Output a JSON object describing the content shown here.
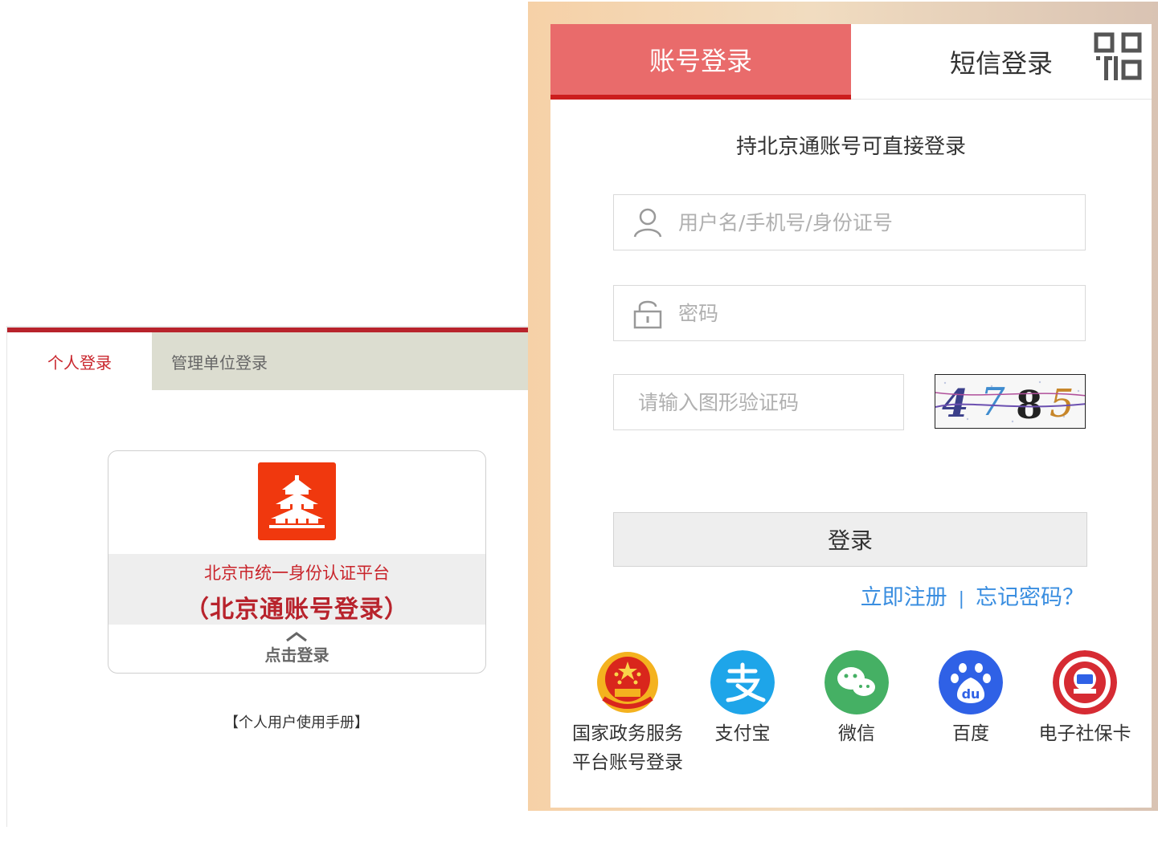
{
  "left": {
    "tabs": {
      "personal": "个人登录",
      "org": "管理单位登录"
    },
    "card": {
      "line1": "北京市统一身份认证平台",
      "line2": "（北京通账号登录）",
      "click": "点击登录"
    },
    "manual": "【个人用户使用手册】"
  },
  "right": {
    "tabs": {
      "account": "账号登录",
      "sms": "短信登录"
    },
    "subtitle": "持北京通账号可直接登录",
    "username_placeholder": "用户名/手机号/身份证号",
    "password_placeholder": "密码",
    "captcha_placeholder": "请输入图形验证码",
    "captcha_code": "4785",
    "login": "登录",
    "register": "立即注册",
    "separator": "|",
    "forgot": "忘记密码？",
    "third_party": [
      {
        "label": "国家政务服务平台账号登录",
        "icon": "national-emblem-icon",
        "color": "#d9261c"
      },
      {
        "label": "支付宝",
        "icon": "alipay-icon",
        "color": "#1ea5e9"
      },
      {
        "label": "微信",
        "icon": "wechat-icon",
        "color": "#45b064"
      },
      {
        "label": "百度",
        "icon": "baidu-icon",
        "color": "#2f61e6"
      },
      {
        "label": "电子社保卡",
        "icon": "social-security-icon",
        "color": "#d62b33"
      }
    ]
  },
  "colors": {
    "accent_red": "#cc1d1d",
    "tab_red": "#e96b6b",
    "link_blue": "#3a8ee0"
  }
}
